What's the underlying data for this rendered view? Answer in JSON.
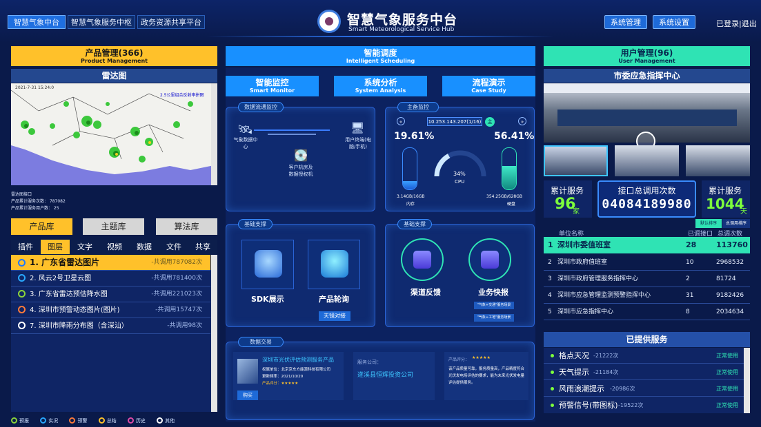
{
  "header": {
    "nav": [
      "智慧气象中台",
      "智慧气象服务中枢",
      "政务资源共享平台"
    ],
    "title": "智慧气象服务中台",
    "subtitle": "Smart Meteorological Service Hub",
    "sys_manage": "系统管理",
    "sys_settings": "系统设置",
    "login": "已登录|退出"
  },
  "left": {
    "head_main": "产品管理(366)",
    "head_sub": "Product Management",
    "radar_title": "雷达图",
    "radar_time": "2021-7-31 15:24:0",
    "radar_label": "2.5公里组合反射率拼图",
    "info": [
      "雷达图接口",
      "产品累计服务次数： 787082",
      "产品累计服务用户数： 25"
    ],
    "lib_buttons": [
      "产品库",
      "主题库",
      "算法库"
    ],
    "tabs": [
      "插件",
      "图层",
      "文字",
      "视频",
      "数据",
      "文件",
      "共享"
    ],
    "items": [
      {
        "name": "1. 广东省雷达图片",
        "count": "-共调用787082次"
      },
      {
        "name": "2. 风云2号卫星云图",
        "count": "-共调用781400次"
      },
      {
        "name": "3. 广东省雷达预估降水图",
        "count": "-共调用221023次"
      },
      {
        "name": "4. 深圳市预警动态图片(图片)",
        "count": "-共调用15747次"
      },
      {
        "name": "7. 深圳市降雨分布图（含深汕）",
        "count": "-共调用98次"
      }
    ],
    "legend": [
      "预报",
      "实况",
      "预警",
      "总结",
      "历史",
      "其他"
    ]
  },
  "middle": {
    "head_main": "智能调度",
    "head_sub": "Intelligent Scheduling",
    "sub_tabs": [
      {
        "main": "智能监控",
        "sub": "Smart Monitor"
      },
      {
        "main": "系统分析",
        "sub": "System Analysis"
      },
      {
        "main": "流程演示",
        "sub": "Case Study"
      }
    ],
    "data_flow": {
      "tag": "数据流通监控",
      "node1": "气象数据中心",
      "node2": "用户终端(电脑/手机)",
      "node3": "客户机房及数据授权机"
    },
    "host": {
      "tag": "主备监控",
      "ip": "10.253.143.207(1/16)",
      "main_label": "主",
      "mem_pct": "19.61%",
      "disk_pct": "56.41%",
      "cpu_pct": "34%",
      "cpu_label": "CPU",
      "mem_detail": "3.14GB/16GB",
      "mem_label": "内存",
      "disk_detail": "354.25GB/628GB",
      "disk_label": "硬盘"
    },
    "base1": {
      "tag": "基础支撑",
      "sdk": "SDK展示",
      "product": "产品轮询",
      "connect_btn": "天镜对接"
    },
    "base2": {
      "tag": "基础支撑",
      "feedback": "渠道反馈",
      "express": "业务快报",
      "pill1": "\"气象+交通\"服务场景",
      "pill2": "\"气象+工地\"服务场景"
    },
    "trade": {
      "tag": "数据交易",
      "product_title": "深圳市光伏评估预测服务产品",
      "owner": "权属单位：北京京东方能源科技有限公司",
      "update": "更新频率：2021/10/20",
      "rating": "产品评分：★★★★★",
      "buy": "购买",
      "service_label": "服务公司：",
      "service_company": "遂溪县恒辉投资公司",
      "review_label": "产品评分：",
      "review_stars": "★★★★★",
      "review_text": "该产品质量可靠，服务质量高，产品精度符合光伏发电场评估的要求，能为未来光伏发电量评估提供服务。"
    }
  },
  "right": {
    "head_main": "用户管理(96)",
    "head_sub": "User Management",
    "video_title": "市委应急指挥中心",
    "stats": {
      "served_label": "累计服务",
      "served_value": "96",
      "served_unit": "家",
      "api_label": "接口总调用次数",
      "api_value": "04084189980",
      "days_label": "累计服务",
      "days_value": "1044",
      "days_unit": "天"
    },
    "toggle": [
      "默认排序",
      "总调用排序"
    ],
    "table_headers": [
      "单位名称",
      "已调接口",
      "总调次数"
    ],
    "rows": [
      {
        "rank": "1",
        "name": "深圳市委值班室",
        "api": "28",
        "total": "113760"
      },
      {
        "rank": "2",
        "name": "深圳市政府值班室",
        "api": "10",
        "total": "2968532"
      },
      {
        "rank": "3",
        "name": "深圳市政府管理服务指挥中心",
        "api": "2",
        "total": "81724"
      },
      {
        "rank": "4",
        "name": "深圳市应急管理监测预警指挥中心",
        "api": "31",
        "total": "9182426"
      },
      {
        "rank": "5",
        "name": "深圳市应急指挥中心",
        "api": "8",
        "total": "2034634"
      }
    ],
    "services_title": "已提供服务",
    "services": [
      {
        "name": "格点天况",
        "count": "-21222次",
        "status": "正常使用"
      },
      {
        "name": "天气提示",
        "count": "-21184次",
        "status": "正常使用"
      },
      {
        "name": "风雨浪潮提示",
        "count": "-20986次",
        "status": "正常使用"
      },
      {
        "name": "预警信号(带图标)",
        "count": "-19522次",
        "status": "正常使用"
      }
    ]
  },
  "colors": {
    "background": "#0a1a4a",
    "yellow": "#ffc12a",
    "blue": "#1890ff",
    "green": "#2fe3b4",
    "stat_green": "#7dff3c"
  }
}
